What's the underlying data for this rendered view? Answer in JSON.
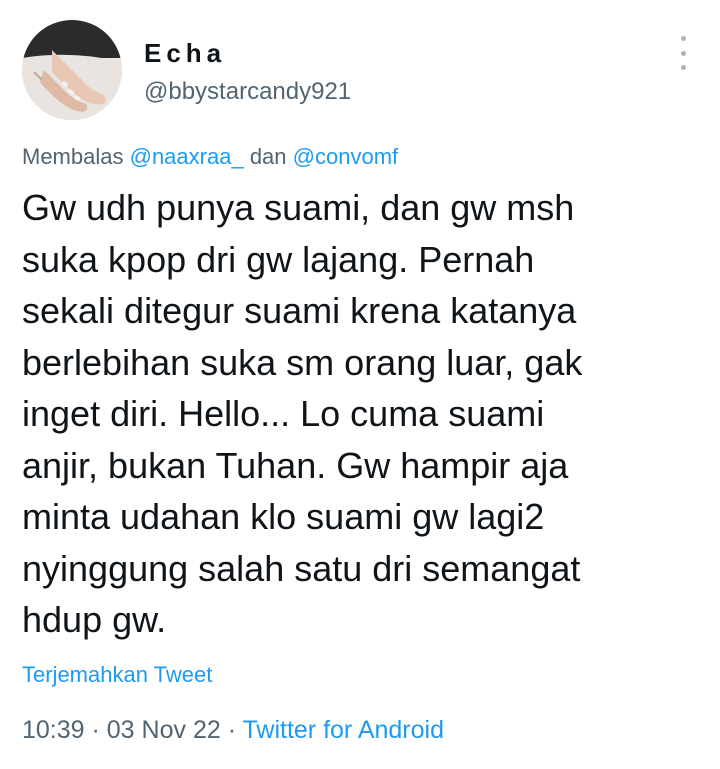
{
  "author": {
    "display_name": "Echa",
    "username": "@bbystarcandy921",
    "avatar_icon": "avatar-photo"
  },
  "more_icon": "more-options-icon",
  "reply": {
    "prefix": "Membalas",
    "mention1": "@naaxraa_",
    "conjunction": "dan",
    "mention2": "@convomf"
  },
  "tweet": {
    "lines": [
      "Gw udh punya suami, dan gw msh",
      "suka kpop dri gw lajang. Pernah",
      "sekali ditegur suami krena katanya",
      "berlebihan suka sm orang luar, gak",
      "inget diri. Hello... Lo cuma suami",
      "anjir, bukan Tuhan. Gw hampir aja",
      "minta udahan klo suami gw lagi2",
      "nyinggung salah satu dri semangat",
      "hdup gw."
    ]
  },
  "translate_label": "Terjemahkan Tweet",
  "meta": {
    "time": "10:39",
    "separator1": " · ",
    "date": "03 Nov 22",
    "separator2": " · ",
    "source": "Twitter for Android"
  },
  "colors": {
    "link": "#1d9bf0",
    "secondary": "#536471",
    "primary_text": "#0f1419"
  }
}
